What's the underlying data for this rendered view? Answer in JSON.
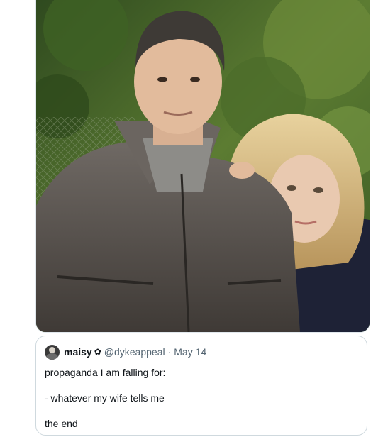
{
  "quoted_tweet": {
    "display_name": "maisy",
    "name_icon": "✿",
    "handle": "@dykeappeal",
    "separator": "·",
    "date": "May 14",
    "lines": [
      "propaganda I am falling for:",
      "- whatever my wife tells me",
      "the end"
    ]
  },
  "media": {
    "icon": "photo-icon",
    "colors": {
      "foliage": "#4a6b2f",
      "jacket": "#5b5550",
      "hair_blonde": "#d9c08a"
    }
  },
  "colors": {
    "border": "#cfd9de",
    "text_primary": "#0f1419",
    "text_secondary": "#536471"
  }
}
